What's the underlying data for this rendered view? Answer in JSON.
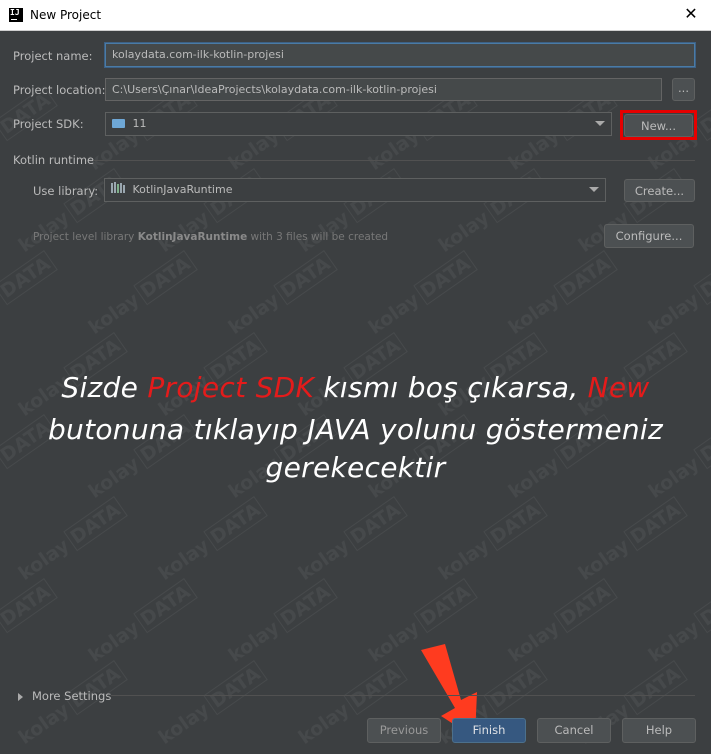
{
  "window": {
    "title": "New Project",
    "close_glyph": "✕"
  },
  "form": {
    "project_name_label": "Project name:",
    "project_name_value": "kolaydata.com-ilk-kotlin-projesi",
    "project_location_label": "Project location:",
    "project_location_value": "C:\\Users\\Çınar\\IdeaProjects\\kolaydata.com-ilk-kotlin-projesi",
    "browse_label": "...",
    "project_sdk_label": "Project SDK:",
    "project_sdk_value": "11",
    "new_button": "New..."
  },
  "kotlin_runtime": {
    "section_title": "Kotlin runtime",
    "use_library_label": "Use library:",
    "library_value": "KotlinJavaRuntime",
    "create_button": "Create...",
    "hint_prefix": "Project level library ",
    "hint_bold": "KotlinJavaRuntime",
    "hint_suffix": " with 3 files will be created",
    "configure_button": "Configure..."
  },
  "overlay": {
    "line1_a": "Sizde ",
    "line1_red1": "Project SDK",
    "line1_b": " kısmı boş çıkarsa, ",
    "line1_red2": "New",
    "line2": "butonuna tıklayıp JAVA yolunu göstermeniz",
    "line3": "gerekecektir"
  },
  "watermark": {
    "word": "kolay",
    "box": "DATA"
  },
  "footer": {
    "more_settings": "More Settings",
    "previous": "Previous",
    "finish": "Finish",
    "cancel": "Cancel",
    "help": "Help"
  },
  "colors": {
    "background": "#3c3f41",
    "highlight_red": "#e60000",
    "default_button": "#365880",
    "arrow": "#ff3b1f"
  }
}
